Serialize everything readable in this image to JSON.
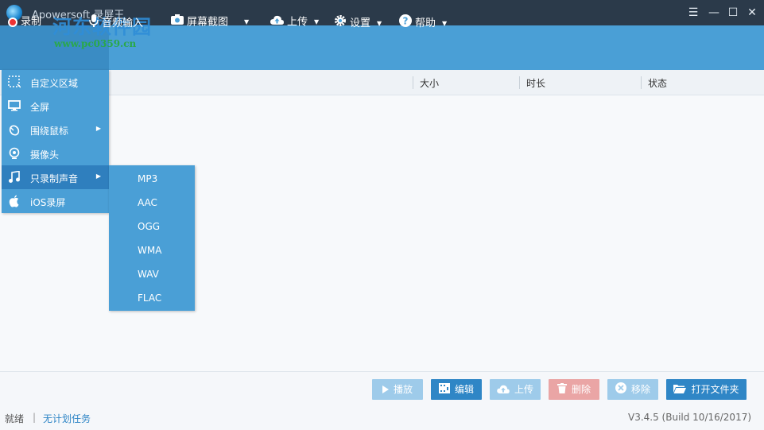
{
  "window": {
    "title": "Apowersoft 录屏王",
    "watermark": "河东软件园",
    "watermark_sub": "www.pc0359.cn"
  },
  "toolbar": {
    "record_label": "录制",
    "audio_input_label": "音频输入",
    "screenshot_label": "屏幕截图",
    "upload_label": "上传",
    "settings_label": "设置",
    "help_label": "帮助"
  },
  "table": {
    "columns": [
      "大小",
      "时长",
      "状态"
    ]
  },
  "record_menu": {
    "items": [
      {
        "label": "自定义区域",
        "icon": "region-icon"
      },
      {
        "label": "全屏",
        "icon": "monitor-icon"
      },
      {
        "label": "围绕鼠标",
        "icon": "mouse-icon"
      },
      {
        "label": "摄像头",
        "icon": "webcam-icon"
      },
      {
        "label": "只录制声音",
        "icon": "music-note-icon"
      },
      {
        "label": "iOS录屏",
        "icon": "apple-icon"
      }
    ]
  },
  "audio_submenu": {
    "items": [
      "MP3",
      "AAC",
      "OGG",
      "WMA",
      "WAV",
      "FLAC"
    ]
  },
  "actions": {
    "play": "播放",
    "edit": "编辑",
    "upload": "上传",
    "delete": "删除",
    "remove": "移除",
    "open_folder": "打开文件夹"
  },
  "status": {
    "ready": "就绪",
    "separator": "|",
    "task": "无计划任务",
    "version": "V3.4.5 (Build 10/16/2017)"
  },
  "colors": {
    "titlebar": "#2b3a4a",
    "toolbar": "#4a9fd6",
    "menu_active": "#2f7fbe",
    "primary_button": "#2f86c6",
    "disabled_button": "#9ecbea",
    "delete_button": "#eaa5a5"
  }
}
